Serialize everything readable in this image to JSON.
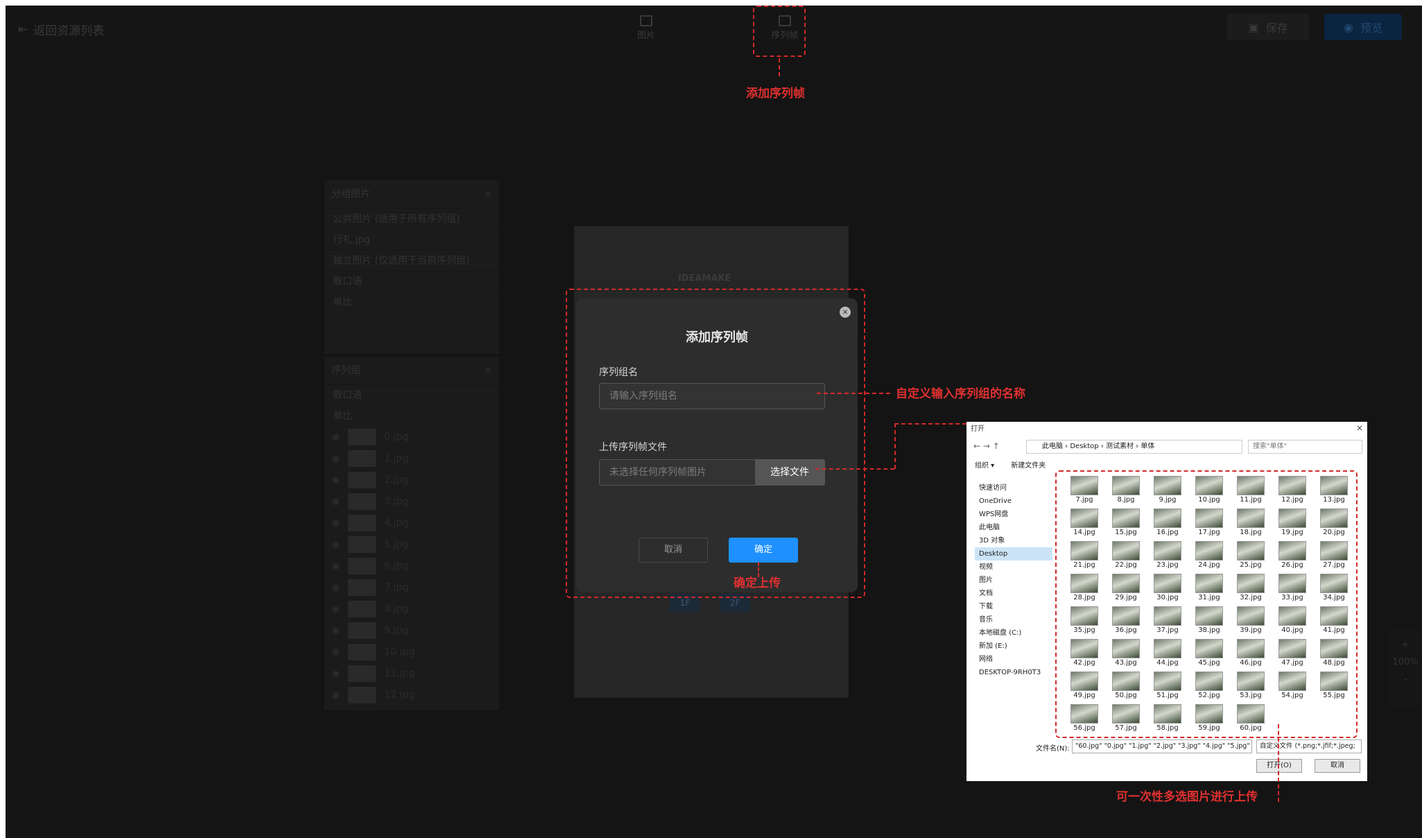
{
  "topbar": {
    "back_label": "返回资源列表",
    "tool_image": "图片",
    "tool_sequence": "序列帧",
    "save_label": "保存",
    "preview_label": "预览"
  },
  "panel_group": {
    "title": "分组图片",
    "row1": "公共图片 (适用于所有序列组)",
    "row2": "行礼.jpg",
    "row3": "独立图片 (仅适用于当前序列组)",
    "row4": "敬口语",
    "row5": "单比"
  },
  "panel_seq": {
    "title": "序列组",
    "row1": "敬口语",
    "row2": "单比",
    "frames": [
      "0.jpg",
      "1.jpg",
      "2.jpg",
      "3.jpg",
      "4.jpg",
      "5.jpg",
      "6.jpg",
      "7.jpg",
      "8.jpg",
      "9.jpg",
      "10.jpg",
      "11.jpg",
      "12.jpg"
    ]
  },
  "canvas": {
    "logo": "IDEAMAKE",
    "floor1": "1F",
    "floor2": "2F"
  },
  "modal": {
    "title": "添加序列帧",
    "close": "×",
    "name_label": "序列组名",
    "name_placeholder": "请输入序列组名",
    "upload_label": "上传序列帧文件",
    "file_placeholder": "未选择任何序列帧图片",
    "file_button": "选择文件",
    "cancel": "取消",
    "confirm": "确定"
  },
  "annotations": {
    "add_sequence": "添加序列帧",
    "custom_name": "自定义输入序列组的名称",
    "confirm_upload": "确定上传",
    "multi_select": "可一次性多选图片进行上传"
  },
  "file_dialog": {
    "title": "打开",
    "path": "此电脑 › Desktop › 测试素材 › 单体",
    "search": "搜索\"单体\"",
    "organize": "组织 ▾",
    "new_folder": "新建文件夹",
    "sidebar": [
      "快速访问",
      "OneDrive",
      "WPS网盘",
      "此电脑",
      "3D 对象",
      "Desktop",
      "视频",
      "图片",
      "文档",
      "下载",
      "音乐",
      "本地磁盘 (C:)",
      "新加 (E:)",
      "网络",
      "DESKTOP-9RH0T3"
    ],
    "files": [
      "7.jpg",
      "8.jpg",
      "9.jpg",
      "10.jpg",
      "11.jpg",
      "12.jpg",
      "13.jpg",
      "14.jpg",
      "15.jpg",
      "16.jpg",
      "17.jpg",
      "18.jpg",
      "19.jpg",
      "20.jpg",
      "21.jpg",
      "22.jpg",
      "23.jpg",
      "24.jpg",
      "25.jpg",
      "26.jpg",
      "27.jpg",
      "28.jpg",
      "29.jpg",
      "30.jpg",
      "31.jpg",
      "32.jpg",
      "33.jpg",
      "34.jpg",
      "35.jpg",
      "36.jpg",
      "37.jpg",
      "38.jpg",
      "39.jpg",
      "40.jpg",
      "41.jpg",
      "42.jpg",
      "43.jpg",
      "44.jpg",
      "45.jpg",
      "46.jpg",
      "47.jpg",
      "48.jpg",
      "49.jpg",
      "50.jpg",
      "51.jpg",
      "52.jpg",
      "53.jpg",
      "54.jpg",
      "55.jpg",
      "56.jpg",
      "57.jpg",
      "58.jpg",
      "59.jpg",
      "60.jpg"
    ],
    "filename_label": "文件名(N):",
    "filename_value": "\"60.jpg\" \"0.jpg\" \"1.jpg\" \"2.jpg\" \"3.jpg\" \"4.jpg\" \"5.jpg\"",
    "filetype": "自定义文件 (*.png;*.jfif;*.jpeg;",
    "open": "打开(O)",
    "cancel": "取消"
  },
  "zoom": {
    "plus": "+",
    "value": "100%",
    "minus": "-"
  },
  "colors": {
    "accent_blue": "#1e90ff",
    "annotation_red": "#d42a2a"
  }
}
